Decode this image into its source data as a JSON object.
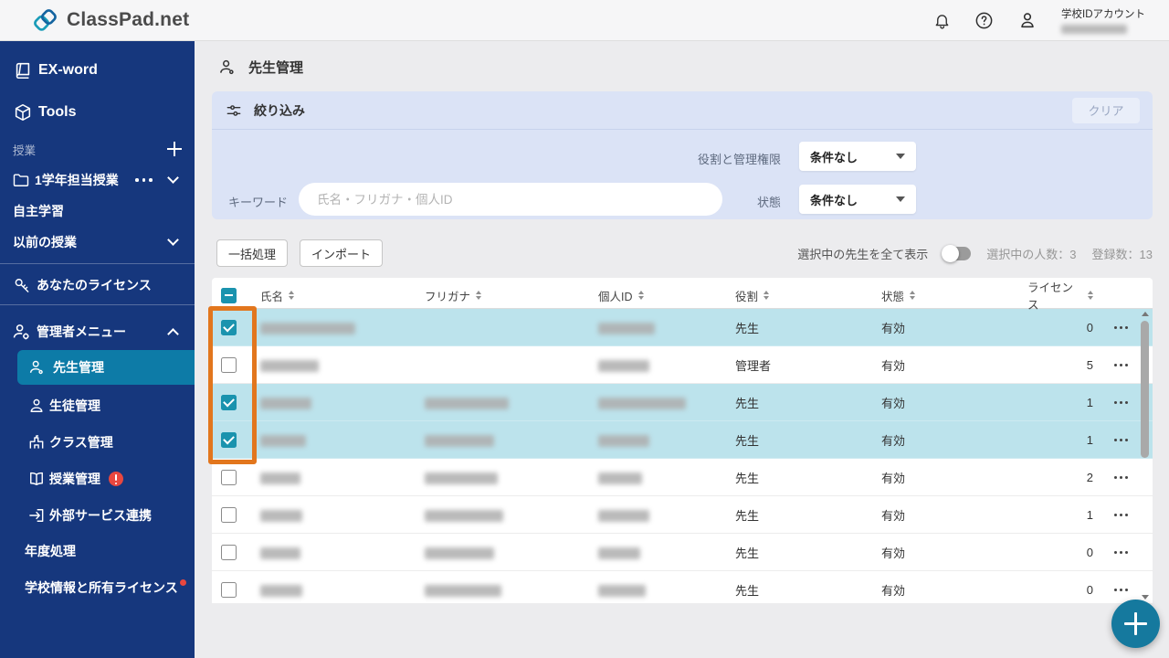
{
  "header": {
    "logo_text": "ClassPad.net",
    "account_label": "学校IDアカウント"
  },
  "sidebar": {
    "ex_word": "EX-word",
    "tools": "Tools",
    "section_classes": "授業",
    "class_folder": "1学年担当授業",
    "self_study": "自主学習",
    "previous_classes": "以前の授業",
    "your_license": "あなたのライセンス",
    "admin_menu": "管理者メニュー",
    "teacher_mgmt": "先生管理",
    "student_mgmt": "生徒管理",
    "class_mgmt": "クラス管理",
    "lesson_mgmt": "授業管理",
    "external_services": "外部サービス連携",
    "year_end": "年度処理",
    "school_info": "学校情報と所有ライセンス"
  },
  "main": {
    "page_title": "先生管理",
    "filter": {
      "title": "絞り込み",
      "clear": "クリア",
      "role_label": "役割と管理権限",
      "role_value": "条件なし",
      "keyword_label": "キーワード",
      "keyword_placeholder": "氏名・フリガナ・個人ID",
      "status_label": "状態",
      "status_value": "条件なし"
    },
    "toolbar": {
      "bulk": "一括処理",
      "import": "インポート",
      "show_selected": "選択中の先生を全て表示",
      "selected_count": "選択中の人数：3",
      "registered_count": "登録数：13"
    },
    "table": {
      "columns": [
        "氏名",
        "フリガナ",
        "個人ID",
        "役割",
        "状態",
        "ライセンス"
      ],
      "rows": [
        {
          "selected": true,
          "checked": true,
          "name_w": 104,
          "furigana_w": 0,
          "id_w": 62,
          "role": "先生",
          "status": "有効",
          "license": "0"
        },
        {
          "selected": false,
          "checked": false,
          "name_w": 64,
          "furigana_w": 0,
          "id_w": 56,
          "role": "管理者",
          "status": "有効",
          "license": "5"
        },
        {
          "selected": true,
          "checked": true,
          "name_w": 56,
          "furigana_w": 92,
          "id_w": 96,
          "role": "先生",
          "status": "有効",
          "license": "1"
        },
        {
          "selected": true,
          "checked": true,
          "name_w": 50,
          "furigana_w": 76,
          "id_w": 56,
          "role": "先生",
          "status": "有効",
          "license": "1"
        },
        {
          "selected": false,
          "checked": false,
          "name_w": 44,
          "furigana_w": 80,
          "id_w": 48,
          "role": "先生",
          "status": "有効",
          "license": "2"
        },
        {
          "selected": false,
          "checked": false,
          "name_w": 46,
          "furigana_w": 86,
          "id_w": 56,
          "role": "先生",
          "status": "有効",
          "license": "1"
        },
        {
          "selected": false,
          "checked": false,
          "name_w": 44,
          "furigana_w": 76,
          "id_w": 46,
          "role": "先生",
          "status": "有効",
          "license": "0"
        },
        {
          "selected": false,
          "checked": false,
          "name_w": 46,
          "furigana_w": 84,
          "id_w": 52,
          "role": "先生",
          "status": "有効",
          "license": "0"
        }
      ]
    }
  }
}
